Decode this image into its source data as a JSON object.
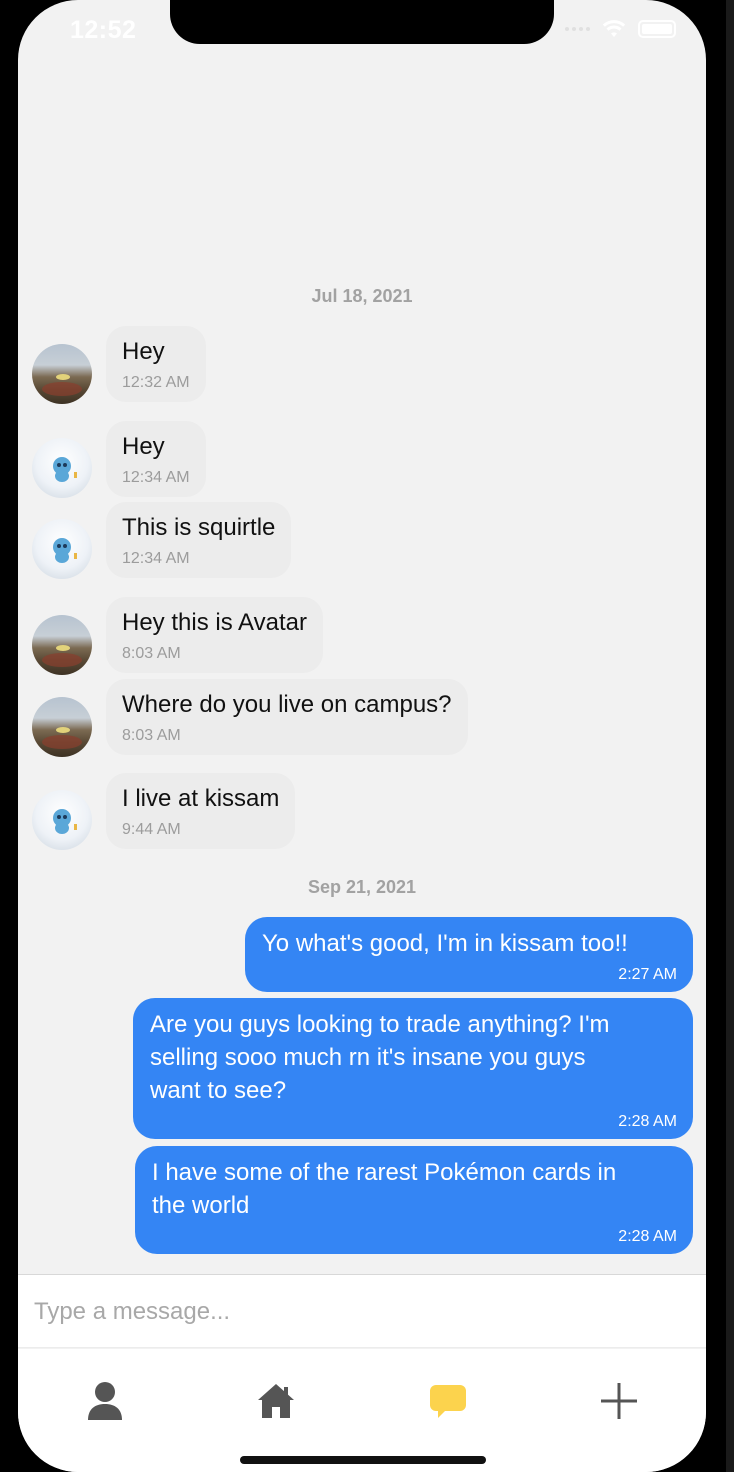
{
  "status_bar": {
    "time": "12:52"
  },
  "chat": {
    "date_separators": [
      "Jul 18, 2021",
      "Sep 21, 2021"
    ],
    "incoming": [
      {
        "avatar": "landscape-avatar",
        "text": "Hey",
        "time": "12:32 AM"
      },
      {
        "avatar": "squirtle-avatar",
        "text": "Hey",
        "time": "12:34 AM"
      },
      {
        "avatar": "squirtle-avatar",
        "text": "This is squirtle",
        "time": "12:34 AM"
      },
      {
        "avatar": "landscape-avatar",
        "text": "Hey this is Avatar",
        "time": "8:03 AM"
      },
      {
        "avatar": "landscape-avatar",
        "text": "Where do you live on campus?",
        "time": "8:03 AM"
      },
      {
        "avatar": "squirtle-avatar",
        "text": "I live at kissam",
        "time": "9:44 AM"
      }
    ],
    "outgoing": [
      {
        "lines": [
          "Yo what's good, I'm in kissam too!!"
        ],
        "time": "2:27 AM"
      },
      {
        "lines": [
          "Are you guys looking to trade anything? I'm",
          "selling sooo much rn it's insane you guys",
          "want to see?"
        ],
        "time": "2:28 AM"
      },
      {
        "lines": [
          "I have some of the rarest Pokémon cards in",
          "the world"
        ],
        "time": "2:28 AM"
      }
    ]
  },
  "composer": {
    "placeholder": "Type a message...",
    "value": ""
  },
  "tabbar": {
    "tabs": [
      {
        "icon": "person-icon",
        "active": false
      },
      {
        "icon": "home-icon",
        "active": false
      },
      {
        "icon": "chat-bubble-icon",
        "active": true
      },
      {
        "icon": "plus-icon",
        "active": false
      }
    ],
    "active_color": "#fcd34d",
    "inactive_color": "#555555"
  },
  "colors": {
    "outgoing_bubble": "#3485f4",
    "incoming_bubble": "#ececec",
    "background": "#f2f2f2"
  }
}
